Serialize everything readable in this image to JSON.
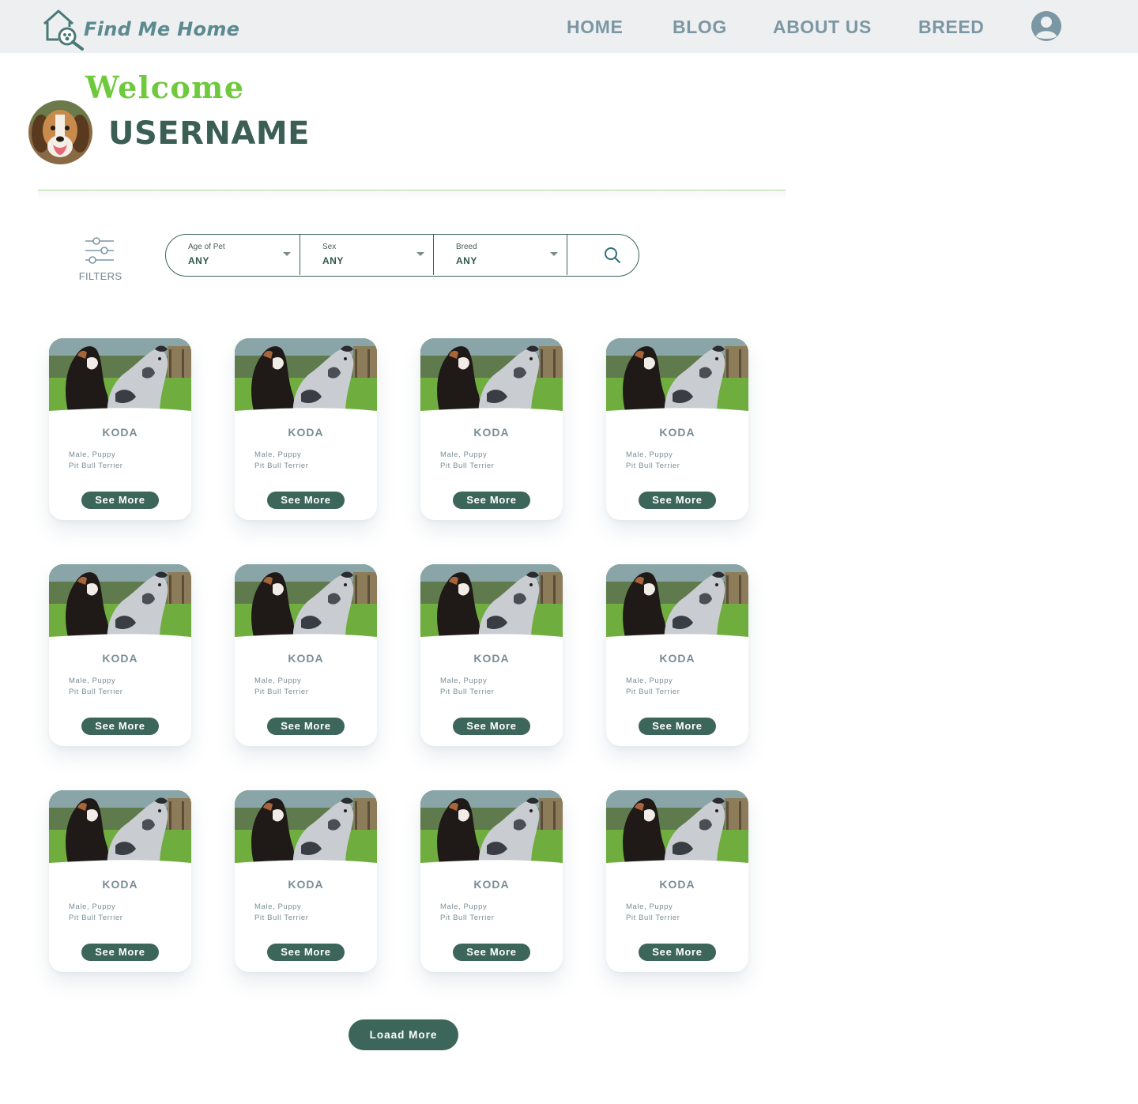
{
  "header": {
    "brand": "Find Me Home",
    "nav": [
      "HOME",
      "BLOG",
      "ABOUT US",
      "BREED"
    ],
    "account_icon": "user-circle-icon"
  },
  "welcome": {
    "greeting": "Welcome",
    "username": "USERNAME",
    "avatar": "beagle-photo"
  },
  "filters": {
    "label": "FILTERS",
    "icon": "sliders-icon",
    "age": {
      "caption": "Age of Pet",
      "value": "ANY"
    },
    "sex": {
      "caption": "Sex",
      "value": "ANY"
    },
    "breed": {
      "caption": "Breed",
      "value": "ANY"
    },
    "search_icon": "search-icon"
  },
  "pets": [
    {
      "name": "KODA",
      "details": "Male, Puppy",
      "breed": "Pit Bull Terrier",
      "button": "See More"
    },
    {
      "name": "KODA",
      "details": "Male, Puppy",
      "breed": "Pit Bull Terrier",
      "button": "See More"
    },
    {
      "name": "KODA",
      "details": "Male, Puppy",
      "breed": "Pit Bull Terrier",
      "button": "See More"
    },
    {
      "name": "KODA",
      "details": "Male, Puppy",
      "breed": "Pit Bull Terrier",
      "button": "See More"
    },
    {
      "name": "KODA",
      "details": "Male, Puppy",
      "breed": "Pit Bull Terrier",
      "button": "See More"
    },
    {
      "name": "KODA",
      "details": "Male, Puppy",
      "breed": "Pit Bull Terrier",
      "button": "See More"
    },
    {
      "name": "KODA",
      "details": "Male, Puppy",
      "breed": "Pit Bull Terrier",
      "button": "See More"
    },
    {
      "name": "KODA",
      "details": "Male, Puppy",
      "breed": "Pit Bull Terrier",
      "button": "See More"
    },
    {
      "name": "KODA",
      "details": "Male, Puppy",
      "breed": "Pit Bull Terrier",
      "button": "See More"
    },
    {
      "name": "KODA",
      "details": "Male, Puppy",
      "breed": "Pit Bull Terrier",
      "button": "See More"
    },
    {
      "name": "KODA",
      "details": "Male, Puppy",
      "breed": "Pit Bull Terrier",
      "button": "See More"
    },
    {
      "name": "KODA",
      "details": "Male, Puppy",
      "breed": "Pit Bull Terrier",
      "button": "See More"
    }
  ],
  "load_more": "Loaad More",
  "colors": {
    "brand_green": "#3c6659",
    "welcome_green": "#6fc93c",
    "muted_blue": "#7b97a3"
  }
}
